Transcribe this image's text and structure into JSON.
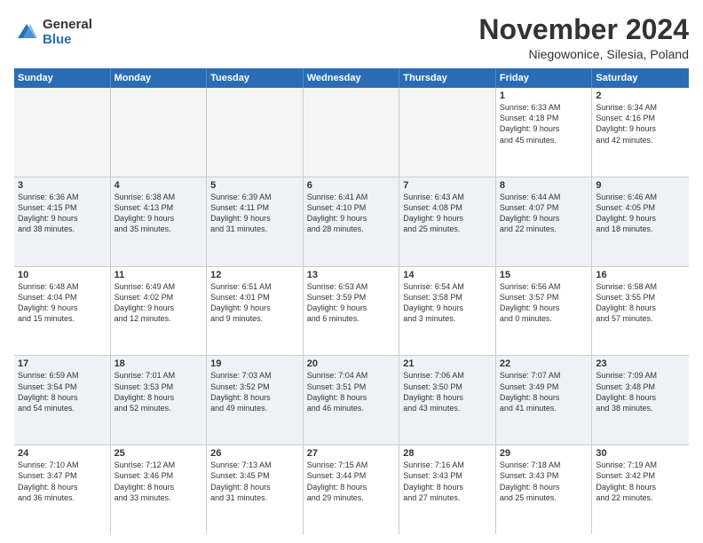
{
  "logo": {
    "general": "General",
    "blue": "Blue"
  },
  "title": "November 2024",
  "subtitle": "Niegowonice, Silesia, Poland",
  "headers": [
    "Sunday",
    "Monday",
    "Tuesday",
    "Wednesday",
    "Thursday",
    "Friday",
    "Saturday"
  ],
  "rows": [
    [
      {
        "day": "",
        "info": "",
        "empty": true
      },
      {
        "day": "",
        "info": "",
        "empty": true
      },
      {
        "day": "",
        "info": "",
        "empty": true
      },
      {
        "day": "",
        "info": "",
        "empty": true
      },
      {
        "day": "",
        "info": "",
        "empty": true
      },
      {
        "day": "1",
        "info": "Sunrise: 6:33 AM\nSunset: 4:18 PM\nDaylight: 9 hours\nand 45 minutes."
      },
      {
        "day": "2",
        "info": "Sunrise: 6:34 AM\nSunset: 4:16 PM\nDaylight: 9 hours\nand 42 minutes."
      }
    ],
    [
      {
        "day": "3",
        "info": "Sunrise: 6:36 AM\nSunset: 4:15 PM\nDaylight: 9 hours\nand 38 minutes."
      },
      {
        "day": "4",
        "info": "Sunrise: 6:38 AM\nSunset: 4:13 PM\nDaylight: 9 hours\nand 35 minutes."
      },
      {
        "day": "5",
        "info": "Sunrise: 6:39 AM\nSunset: 4:11 PM\nDaylight: 9 hours\nand 31 minutes."
      },
      {
        "day": "6",
        "info": "Sunrise: 6:41 AM\nSunset: 4:10 PM\nDaylight: 9 hours\nand 28 minutes."
      },
      {
        "day": "7",
        "info": "Sunrise: 6:43 AM\nSunset: 4:08 PM\nDaylight: 9 hours\nand 25 minutes."
      },
      {
        "day": "8",
        "info": "Sunrise: 6:44 AM\nSunset: 4:07 PM\nDaylight: 9 hours\nand 22 minutes."
      },
      {
        "day": "9",
        "info": "Sunrise: 6:46 AM\nSunset: 4:05 PM\nDaylight: 9 hours\nand 18 minutes."
      }
    ],
    [
      {
        "day": "10",
        "info": "Sunrise: 6:48 AM\nSunset: 4:04 PM\nDaylight: 9 hours\nand 15 minutes."
      },
      {
        "day": "11",
        "info": "Sunrise: 6:49 AM\nSunset: 4:02 PM\nDaylight: 9 hours\nand 12 minutes."
      },
      {
        "day": "12",
        "info": "Sunrise: 6:51 AM\nSunset: 4:01 PM\nDaylight: 9 hours\nand 9 minutes."
      },
      {
        "day": "13",
        "info": "Sunrise: 6:53 AM\nSunset: 3:59 PM\nDaylight: 9 hours\nand 6 minutes."
      },
      {
        "day": "14",
        "info": "Sunrise: 6:54 AM\nSunset: 3:58 PM\nDaylight: 9 hours\nand 3 minutes."
      },
      {
        "day": "15",
        "info": "Sunrise: 6:56 AM\nSunset: 3:57 PM\nDaylight: 9 hours\nand 0 minutes."
      },
      {
        "day": "16",
        "info": "Sunrise: 6:58 AM\nSunset: 3:55 PM\nDaylight: 8 hours\nand 57 minutes."
      }
    ],
    [
      {
        "day": "17",
        "info": "Sunrise: 6:59 AM\nSunset: 3:54 PM\nDaylight: 8 hours\nand 54 minutes."
      },
      {
        "day": "18",
        "info": "Sunrise: 7:01 AM\nSunset: 3:53 PM\nDaylight: 8 hours\nand 52 minutes."
      },
      {
        "day": "19",
        "info": "Sunrise: 7:03 AM\nSunset: 3:52 PM\nDaylight: 8 hours\nand 49 minutes."
      },
      {
        "day": "20",
        "info": "Sunrise: 7:04 AM\nSunset: 3:51 PM\nDaylight: 8 hours\nand 46 minutes."
      },
      {
        "day": "21",
        "info": "Sunrise: 7:06 AM\nSunset: 3:50 PM\nDaylight: 8 hours\nand 43 minutes."
      },
      {
        "day": "22",
        "info": "Sunrise: 7:07 AM\nSunset: 3:49 PM\nDaylight: 8 hours\nand 41 minutes."
      },
      {
        "day": "23",
        "info": "Sunrise: 7:09 AM\nSunset: 3:48 PM\nDaylight: 8 hours\nand 38 minutes."
      }
    ],
    [
      {
        "day": "24",
        "info": "Sunrise: 7:10 AM\nSunset: 3:47 PM\nDaylight: 8 hours\nand 36 minutes."
      },
      {
        "day": "25",
        "info": "Sunrise: 7:12 AM\nSunset: 3:46 PM\nDaylight: 8 hours\nand 33 minutes."
      },
      {
        "day": "26",
        "info": "Sunrise: 7:13 AM\nSunset: 3:45 PM\nDaylight: 8 hours\nand 31 minutes."
      },
      {
        "day": "27",
        "info": "Sunrise: 7:15 AM\nSunset: 3:44 PM\nDaylight: 8 hours\nand 29 minutes."
      },
      {
        "day": "28",
        "info": "Sunrise: 7:16 AM\nSunset: 3:43 PM\nDaylight: 8 hours\nand 27 minutes."
      },
      {
        "day": "29",
        "info": "Sunrise: 7:18 AM\nSunset: 3:43 PM\nDaylight: 8 hours\nand 25 minutes."
      },
      {
        "day": "30",
        "info": "Sunrise: 7:19 AM\nSunset: 3:42 PM\nDaylight: 8 hours\nand 22 minutes."
      }
    ]
  ]
}
